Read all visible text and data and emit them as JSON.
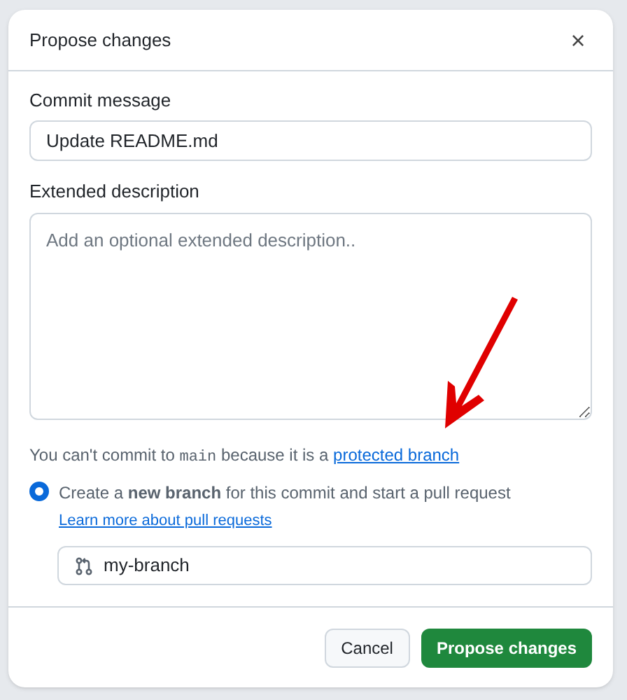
{
  "dialog": {
    "title": "Propose changes",
    "close": "×"
  },
  "commit_message": {
    "label": "Commit message",
    "value": "Update README.md"
  },
  "extended_description": {
    "label": "Extended description",
    "placeholder": "Add an optional extended description.."
  },
  "notice": {
    "before": "You can't commit to ",
    "code": "main",
    "after": " because it is a ",
    "link": "protected branch"
  },
  "option": {
    "selected": true,
    "label": "Create a **new branch** for this commit and start a pull request",
    "link": "Learn more about pull requests"
  },
  "branch_field": {
    "value": "my-branch"
  },
  "buttons": [
    {
      "label": "Cancel",
      "kind": "secondary"
    },
    {
      "label": "Propose changes",
      "kind": "primary"
    }
  ]
}
